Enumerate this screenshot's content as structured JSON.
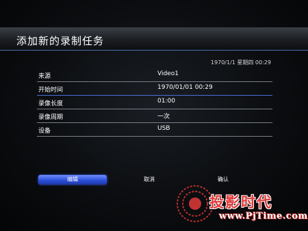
{
  "header": {
    "title": "添加新的录制任务"
  },
  "status": {
    "datetime": "1970/1/1 星期四 00:29"
  },
  "fields": [
    {
      "label": "来源",
      "value": "Video1"
    },
    {
      "label": "开始时间",
      "value": "1970/01/01 00:29"
    },
    {
      "label": "录像长度",
      "value": "01:00"
    },
    {
      "label": "录像周期",
      "value": "一次"
    },
    {
      "label": "设备",
      "value": "USB"
    }
  ],
  "buttons": {
    "edit": "编辑",
    "cancel": "取消",
    "confirm": "确认"
  },
  "watermark": {
    "brand": "投影时代",
    "site": "www.PjTime.com"
  },
  "colors": {
    "accent": "#2a4cd4",
    "brand_red": "#e23a3a"
  }
}
